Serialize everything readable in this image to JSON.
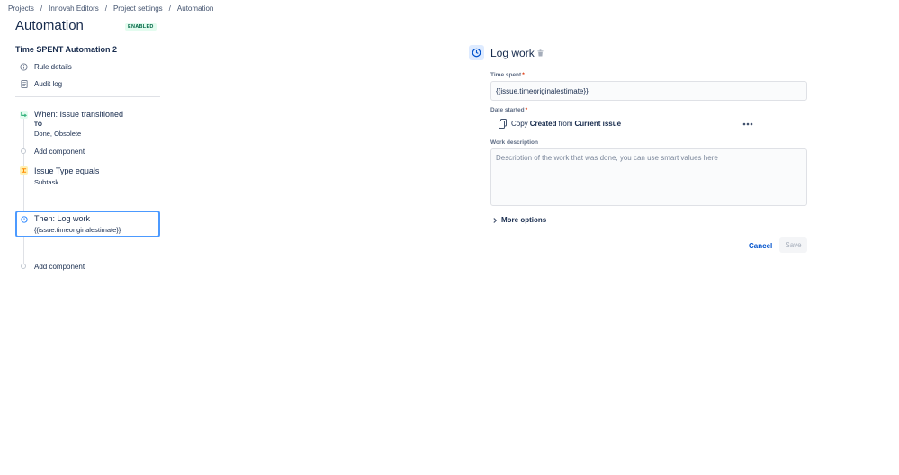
{
  "breadcrumb": {
    "items": [
      "Projects",
      "Innovah Editors",
      "Project settings",
      "Automation"
    ],
    "separator": "/"
  },
  "page": {
    "title": "Automation",
    "status": "ENABLED"
  },
  "rule": {
    "name": "Time SPENT Automation 2",
    "links": {
      "details": "Rule details",
      "audit": "Audit log"
    }
  },
  "components": {
    "trigger": {
      "title": "When: Issue transitioned",
      "to_label": "TO",
      "statuses": "Done, Obsolete",
      "icon": "trigger-icon"
    },
    "add_component_label": "Add component",
    "condition": {
      "title": "Issue Type equals",
      "value": "Subtask",
      "icon": "condition-icon"
    },
    "action": {
      "title": "Then: Log work",
      "value": "{{issue.timeoriginalestimate}}",
      "icon": "clock-icon"
    }
  },
  "panel": {
    "title": "Log work",
    "time_spent": {
      "label": "Time spent",
      "required": "*",
      "value": "{{issue.timeoriginalestimate}}"
    },
    "date_started": {
      "label": "Date started",
      "required": "*",
      "copy_prefix": "Copy",
      "copy_field": "Created",
      "copy_from": "from",
      "copy_source": "Current issue"
    },
    "work_description": {
      "label": "Work description",
      "placeholder": "Description of the work that was done, you can use smart values here"
    },
    "more_options": "More options",
    "cancel": "Cancel",
    "save": "Save"
  },
  "colors": {
    "accent": "#0052cc",
    "focus": "#4c9aff",
    "trigger": "#36b37e",
    "condition": "#ffab00",
    "action": "#2684ff",
    "success_bg": "#e3fcef",
    "success_text": "#006644"
  }
}
